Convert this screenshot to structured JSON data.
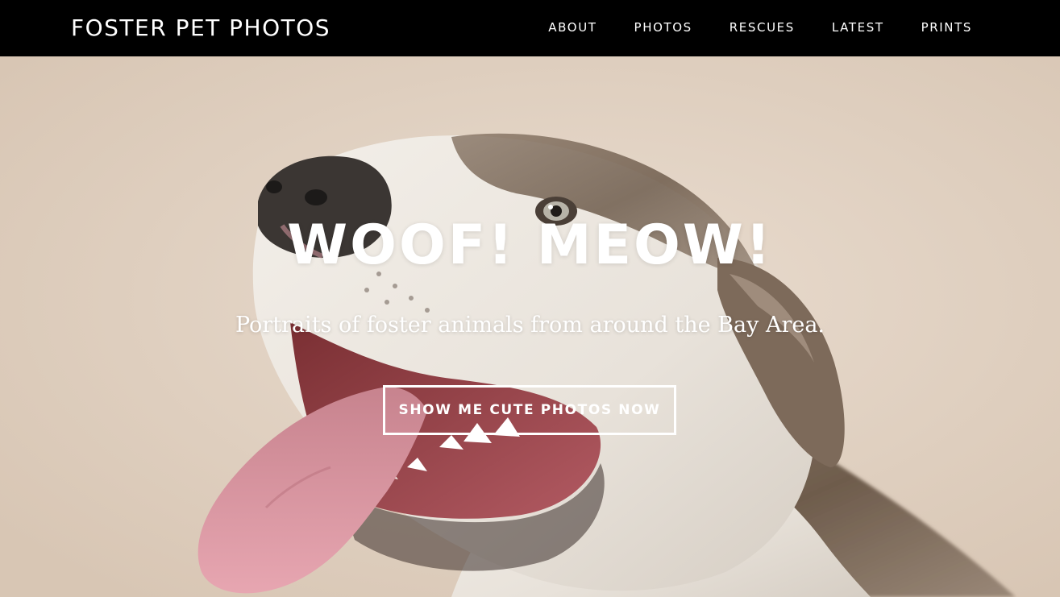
{
  "navbar": {
    "brand": "FOSTER PET PHOTOS",
    "links": [
      {
        "label": "ABOUT"
      },
      {
        "label": "PHOTOS"
      },
      {
        "label": "RESCUES"
      },
      {
        "label": "LATEST"
      },
      {
        "label": "PRINTS"
      }
    ]
  },
  "hero": {
    "title": "WOOF! MEOW!",
    "subtitle": "Portraits of foster animals from around the Bay Area.",
    "cta_label": "SHOW ME CUTE PHOTOS NOW",
    "image_subject": "smiling-dog-photo"
  },
  "colors": {
    "navbar_bg": "#000000",
    "nav_text": "#ffffff",
    "hero_bg": "#e0d0c0",
    "hero_text": "#ffffff"
  }
}
